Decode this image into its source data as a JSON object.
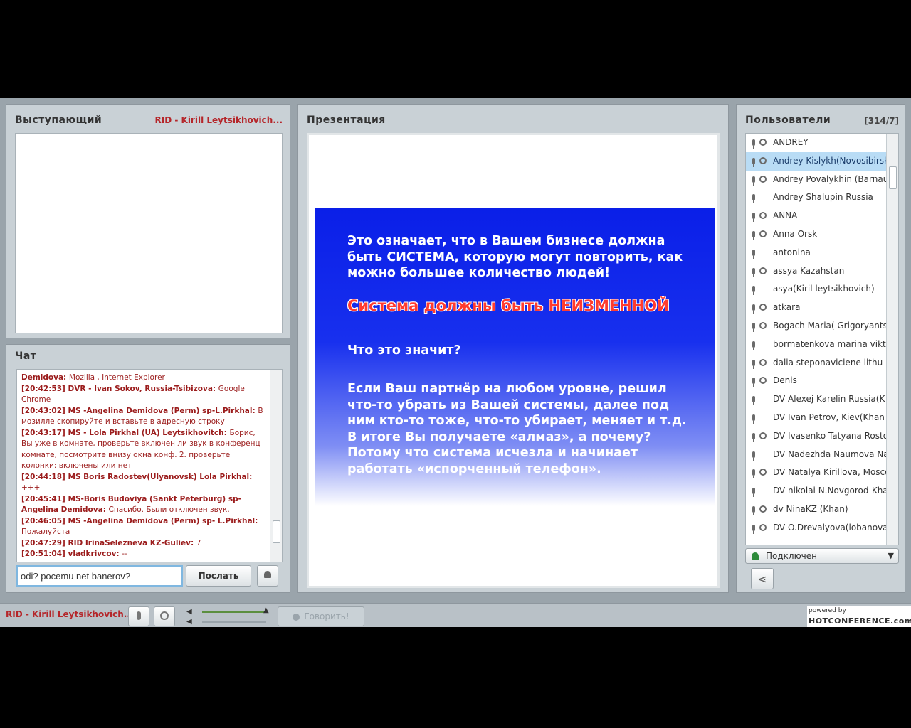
{
  "speaker": {
    "title": "Выступающий",
    "name": "RID - Kirill Leytsikhovich..."
  },
  "chat": {
    "title": "Чат",
    "messages": [
      {
        "time": "",
        "sender": "Demidova: ",
        "text": "Mozilla , Internet Explorer"
      },
      {
        "time": "[20:42:53] ",
        "sender": "DVR - Ivan Sokov, Russia-Tsibizova: ",
        "text": "Google Chrome"
      },
      {
        "time": "[20:43:02] ",
        "sender": "MS -Angelina Demidova (Perm) sp-L.Pirkhal: ",
        "text": "В мозилле скопируйте и вставьте в адресную строку"
      },
      {
        "time": "[20:43:17] ",
        "sender": "MS - Lola Pirkhal (UA) Leytsikhovitch: ",
        "text": "Борис, Вы уже в комнате, проверьте включен ли звук в конференц комнате, посмотрите внизу окна конф. 2. проверьте колонки: включены или нет"
      },
      {
        "time": "[20:44:18] ",
        "sender": "MS Boris Radostev(Ulyanovsk) Lola Pirkhal: ",
        "text": "+++"
      },
      {
        "time": "[20:45:41] ",
        "sender": "MS-Boris Budoviya (Sankt Peterburg) sp- Angelina Demidova: ",
        "text": "Спасибо. Были отключен звук."
      },
      {
        "time": "[20:46:05] ",
        "sender": "MS -Angelina Demidova (Perm) sp- L.Pirkhal: ",
        "text": "Пожалуйста"
      },
      {
        "time": "[20:47:29] ",
        "sender": "RID IrinaSelezneva KZ-Guliev: ",
        "text": "7"
      },
      {
        "time": "[20:51:04] ",
        "sender": "vladkrivcov: ",
        "text": "--"
      }
    ],
    "input_value": "odi? pocemu net banerov?",
    "send_label": "Послать"
  },
  "presentation": {
    "title": "Презентация",
    "para1": "Это означает, что в Вашем бизнесе должна быть СИСТЕМА, которую могут повторить, как можно большее количество людей!",
    "headline": "Система должны быть НЕИЗМЕННОЙ",
    "question": "Что это значит?",
    "para2": "Если Ваш партнёр на любом уровне, решил что-то убрать из Вашей системы, далее под ним кто-то тоже, что-то убирает, меняет и т.д.  В итоге Вы получаете «алмаз», а почему? Потому что система исчезла и начинает работать «испорченный телефон»."
  },
  "users": {
    "title": "Пользователи",
    "count": "[314/7]",
    "list": [
      {
        "name": "ANDREY",
        "cam": true,
        "selected": false
      },
      {
        "name": "Andrey Kislykh(Novosibirsk",
        "cam": true,
        "selected": true
      },
      {
        "name": "Andrey Povalykhin (Barnau",
        "cam": true,
        "selected": false
      },
      {
        "name": "Andrey Shalupin Russia",
        "cam": false,
        "selected": false
      },
      {
        "name": "ANNA",
        "cam": true,
        "selected": false
      },
      {
        "name": "Anna Orsk",
        "cam": true,
        "selected": false
      },
      {
        "name": "antonina",
        "cam": false,
        "selected": false
      },
      {
        "name": "assya Kazahstan",
        "cam": true,
        "selected": false
      },
      {
        "name": "asya(Kiril leytsikhovich)",
        "cam": false,
        "selected": false
      },
      {
        "name": "atkara",
        "cam": true,
        "selected": false
      },
      {
        "name": "Bogach Maria( Grigoryants",
        "cam": true,
        "selected": false
      },
      {
        "name": "bormatenkova marina vikt",
        "cam": false,
        "selected": false
      },
      {
        "name": "dalia steponaviciene lithu",
        "cam": true,
        "selected": false
      },
      {
        "name": "Denis",
        "cam": true,
        "selected": false
      },
      {
        "name": "DV Alexej Karelin Russia(K",
        "cam": false,
        "selected": false
      },
      {
        "name": "DV Ivan Petrov, Kiev(Khan",
        "cam": false,
        "selected": false
      },
      {
        "name": "DV Ivasenko Tatyana Rosto",
        "cam": true,
        "selected": false
      },
      {
        "name": "DV Nadezhda Naumova Nav",
        "cam": false,
        "selected": false
      },
      {
        "name": "DV Natalya Kirillova, Mosco",
        "cam": true,
        "selected": false
      },
      {
        "name": "DV nikolai N.Novgorod-Kha",
        "cam": false,
        "selected": false
      },
      {
        "name": "dv NinaKZ (Khan)",
        "cam": true,
        "selected": false
      },
      {
        "name": "DV O.Drevalyova(lobanova)",
        "cam": true,
        "selected": false
      }
    ],
    "status_label": "Подключен"
  },
  "bottom": {
    "name": "RID - Kirill Leytsikhovich...",
    "speak_label": "Говорить!",
    "brand_small": "powered by",
    "brand_big": "HOTCONFERENCE.com"
  },
  "colors": {
    "slide_blue": "#0a1fe8",
    "accent_red": "#b5262a"
  }
}
